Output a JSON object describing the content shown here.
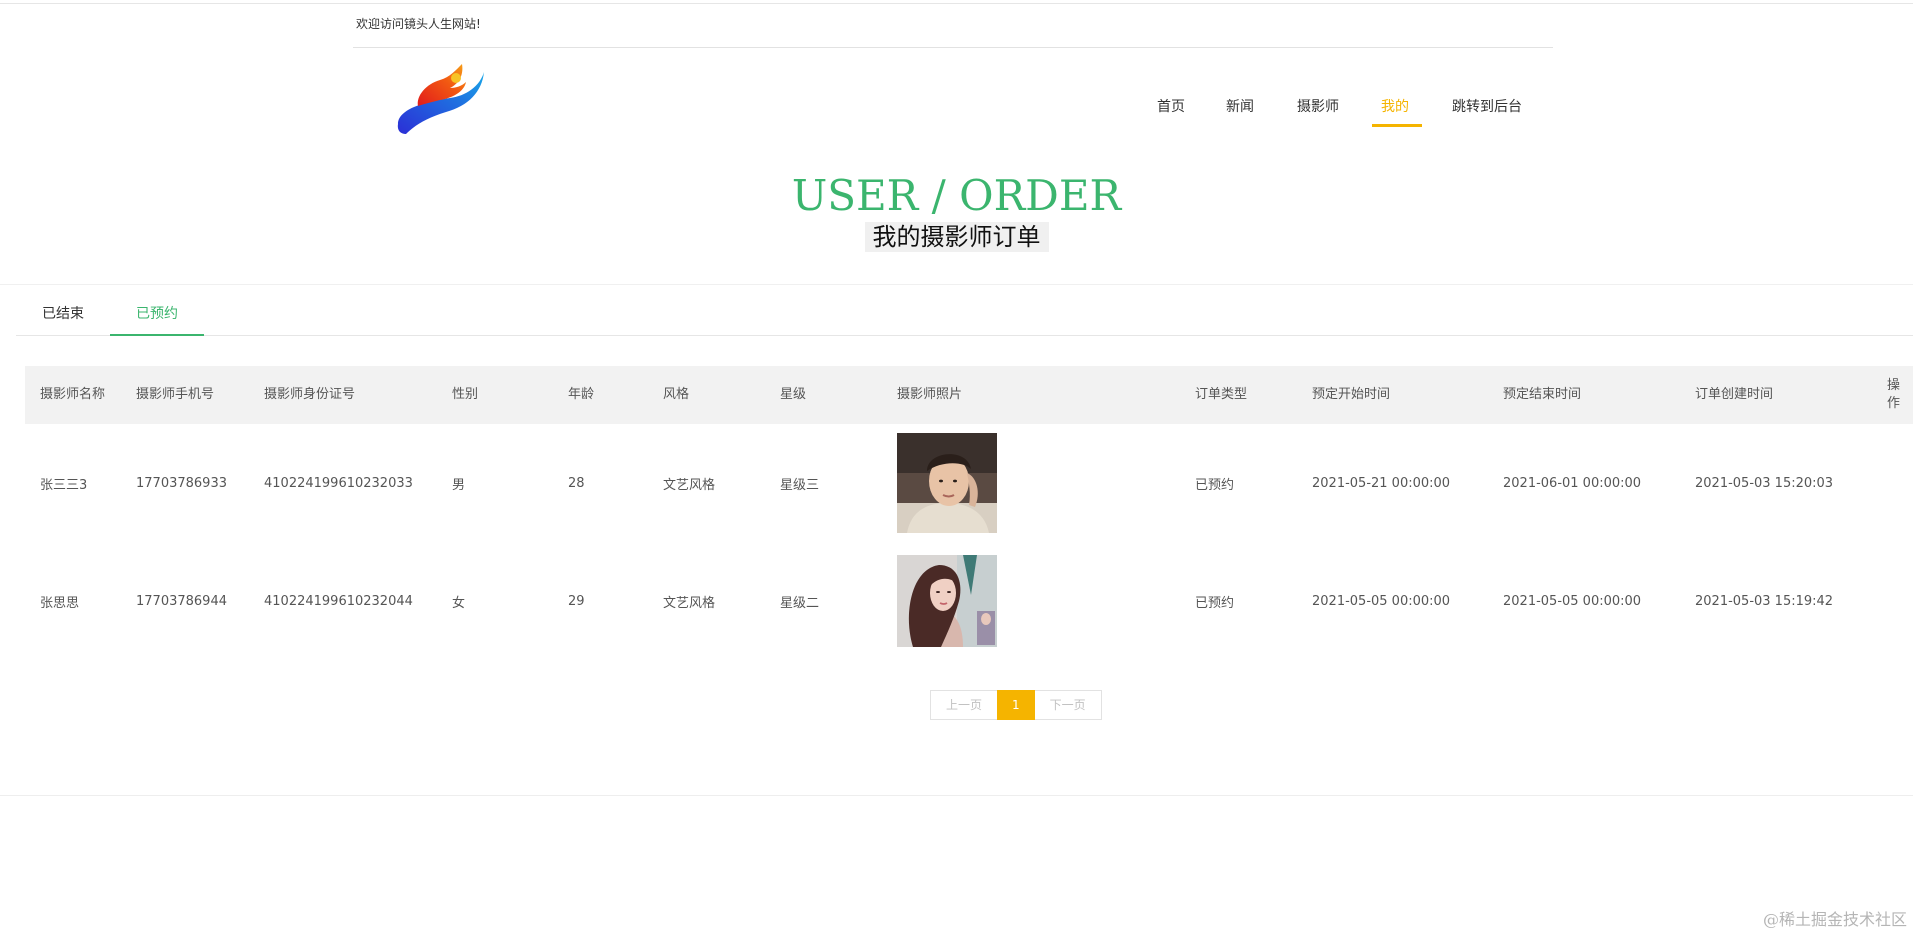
{
  "header": {
    "welcome": "欢迎访问镜头人生网站!",
    "logo_icon": "brand-swoosh-logo"
  },
  "nav": {
    "items": [
      {
        "label": "首页"
      },
      {
        "label": "新闻"
      },
      {
        "label": "摄影师"
      },
      {
        "label": "我的"
      },
      {
        "label": "跳转到后台"
      }
    ],
    "active_index": 3
  },
  "hero": {
    "title_en": "USER / ORDER",
    "title_cn": "我的摄影师订单"
  },
  "tabs": [
    {
      "label": "已结束"
    },
    {
      "label": "已预约"
    }
  ],
  "active_tab": 1,
  "table": {
    "columns": [
      "摄影师名称",
      "摄影师手机号",
      "摄影师身份证号",
      "性别",
      "年龄",
      "风格",
      "星级",
      "摄影师照片",
      "订单类型",
      "预定开始时间",
      "预定结束时间",
      "订单创建时间",
      "操作"
    ],
    "rows": [
      {
        "name": "张三三3",
        "phone": "17703786933",
        "id_number": "410224199610232033",
        "gender": "男",
        "age": "28",
        "style": "文艺风格",
        "star": "星级三",
        "photo": "young-man-portrait",
        "order_type": "已预约",
        "start": "2021-05-21 00:00:00",
        "end": "2021-06-01 00:00:00",
        "created": "2021-05-03 15:20:03"
      },
      {
        "name": "张思思",
        "phone": "17703786944",
        "id_number": "410224199610232044",
        "gender": "女",
        "age": "29",
        "style": "文艺风格",
        "star": "星级二",
        "photo": "illustrated-woman-portrait",
        "order_type": "已预约",
        "start": "2021-05-05 00:00:00",
        "end": "2021-05-05 00:00:00",
        "created": "2021-05-03 15:19:42"
      }
    ]
  },
  "pagination": {
    "prev": "上一页",
    "current": "1",
    "next": "下一页"
  },
  "watermark": "@稀土掘金技术社区",
  "colors": {
    "accent_green": "#3bb56e",
    "accent_yellow": "#f5b400"
  }
}
